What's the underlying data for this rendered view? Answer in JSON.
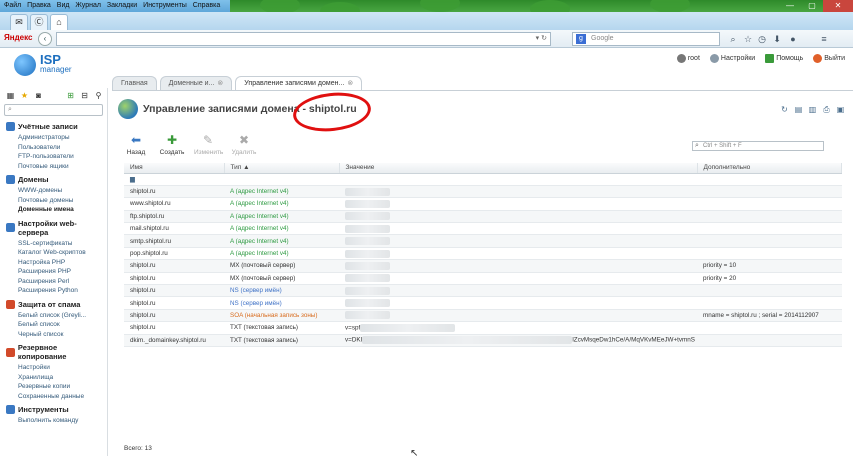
{
  "browser": {
    "menu": [
      "Файл",
      "Правка",
      "Вид",
      "Журнал",
      "Закладки",
      "Инструменты",
      "Справка"
    ],
    "search_brand": "Яндекс",
    "search_placeholder": "Google"
  },
  "header": {
    "logo_main": "ISP",
    "logo_sub": "manager",
    "user": "root",
    "settings_label": "Настройки",
    "help_label": "Помощь",
    "logout_label": "Выйти"
  },
  "tabs": [
    {
      "label": "Главная"
    },
    {
      "label": "Доменные и..."
    },
    {
      "label": "Управление записями домен..."
    }
  ],
  "sidebar": {
    "search_placeholder": "",
    "groups": [
      {
        "title": "Учётные записи",
        "items": [
          "Администраторы",
          "Пользователи",
          "FTP-пользователи",
          "Почтовые ящики"
        ]
      },
      {
        "title": "Домены",
        "items": [
          "WWW-домены",
          "Почтовые домены",
          "Доменные имена"
        ]
      },
      {
        "title": "Настройки web-сервера",
        "items": [
          "SSL-сертификаты",
          "Каталог Web-скриптов",
          "Настройка PHP",
          "Расширения PHP",
          "Расширения Perl",
          "Расширения Python"
        ]
      },
      {
        "title": "Защита от спама",
        "items": [
          "Белый список (Greyli...",
          "Белый список",
          "Черный список"
        ]
      },
      {
        "title": "Резервное копирование",
        "items": [
          "Настройки",
          "Хранилища",
          "Резервные копии",
          "Сохраненные данные"
        ]
      },
      {
        "title": "Инструменты",
        "items": [
          "Выполнить команду"
        ]
      }
    ]
  },
  "page": {
    "title": "Управление записями домена - shiptol.ru",
    "filter_placeholder": "Ctrl + Shift + F",
    "toolbar": {
      "back": "Назад",
      "create": "Создать",
      "edit": "Изменить",
      "delete": "Удалить"
    },
    "columns": {
      "name": "Имя",
      "type": "Тип ▲",
      "value": "Значение",
      "extra": "Дополнительно"
    },
    "total": "Всего: 13"
  },
  "records": [
    {
      "name": "shiptol.ru",
      "type": "A (адрес Internet v4)",
      "kind": "a",
      "value": "",
      "extra": ""
    },
    {
      "name": "www.shiptol.ru",
      "type": "A (адрес Internet v4)",
      "kind": "a",
      "value": "",
      "extra": ""
    },
    {
      "name": "ftp.shiptol.ru",
      "type": "A (адрес Internet v4)",
      "kind": "a",
      "value": "",
      "extra": ""
    },
    {
      "name": "mail.shiptol.ru",
      "type": "A (адрес Internet v4)",
      "kind": "a",
      "value": "",
      "extra": ""
    },
    {
      "name": "smtp.shiptol.ru",
      "type": "A (адрес Internet v4)",
      "kind": "a",
      "value": "",
      "extra": ""
    },
    {
      "name": "pop.shiptol.ru",
      "type": "A (адрес Internet v4)",
      "kind": "a",
      "value": "",
      "extra": ""
    },
    {
      "name": "shiptol.ru",
      "type": "MX (почтовый сервер)",
      "kind": "mx",
      "value": "",
      "extra": "priority = 10"
    },
    {
      "name": "shiptol.ru",
      "type": "MX (почтовый сервер)",
      "kind": "mx",
      "value": "",
      "extra": "priority = 20"
    },
    {
      "name": "shiptol.ru",
      "type": "NS (сервер имён)",
      "kind": "ns",
      "value": "",
      "extra": ""
    },
    {
      "name": "shiptol.ru",
      "type": "NS (сервер имён)",
      "kind": "ns",
      "value": "",
      "extra": ""
    },
    {
      "name": "shiptol.ru",
      "type": "SOA (начальная запись зоны)",
      "kind": "soa",
      "value": "",
      "extra": "mname = shiptol.ru ; serial = 2014112907"
    },
    {
      "name": "shiptol.ru",
      "type": "TXT (текстовая запись)",
      "kind": "txt",
      "value": "v=spf",
      "extra": ""
    },
    {
      "name": "dkim._domainkey.shiptol.ru",
      "type": "TXT (текстовая запись)",
      "kind": "txt",
      "value": "v=DKI",
      "value_tail": "lZcvMsqeDw1hCe/A/MqVKvMEeJW+tvmnS",
      "extra": ""
    }
  ],
  "colors": {
    "accent": "#1d6fbf",
    "a": "#2e9b42",
    "ns": "#3f72c6",
    "soa": "#d86b1c",
    "highlight": "#e01010"
  }
}
